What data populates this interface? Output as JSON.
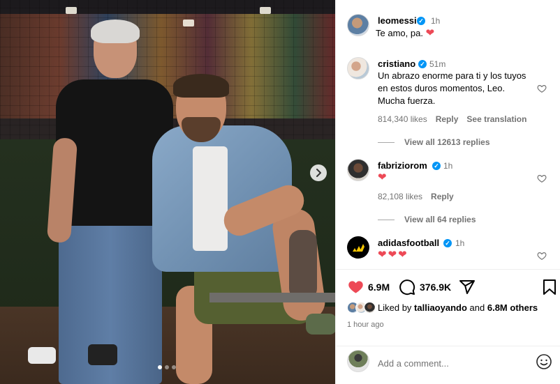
{
  "post": {
    "author": "leomessi",
    "time": "1h",
    "caption": "Te amo, pa.",
    "caption_heart": "❤",
    "media_dots": 3,
    "active_dot": 0
  },
  "comments": [
    {
      "username": "cristiano",
      "time": "51m",
      "text": "Un abrazo enorme para ti y los tuyos en estos duros momentos, Leo. Mucha fuerza.",
      "likes": "814,340 likes",
      "reply": "Reply",
      "translation": "See translation",
      "view_replies": "View all 12613 replies"
    },
    {
      "username": "fabriziorom",
      "time": "1h",
      "text": "❤",
      "likes": "82,108 likes",
      "reply": "Reply",
      "view_replies": "View all 64 replies"
    },
    {
      "username": "adidasfootball",
      "time": "1h",
      "text": "❤❤❤"
    }
  ],
  "actions": {
    "likes_count": "6.9M",
    "comments_count": "376.9K",
    "liked_by_prefix": "Liked by",
    "liked_by_user": "talliaoyando",
    "liked_by_and": "and",
    "liked_by_others": "6.8M others",
    "posted_ago": "1 hour ago"
  },
  "add_comment": {
    "placeholder": "Add a comment..."
  },
  "colors": {
    "verified": "#0095f6",
    "heart": "#ed4956",
    "secondary_text": "#737373",
    "divider": "#efefef"
  },
  "icons": [
    "chevron-right-icon",
    "verified-badge-icon",
    "heart-outline-icon",
    "heart-filled-icon",
    "comment-icon",
    "share-icon",
    "bookmark-icon",
    "emoji-icon",
    "adidas-logo-icon"
  ]
}
